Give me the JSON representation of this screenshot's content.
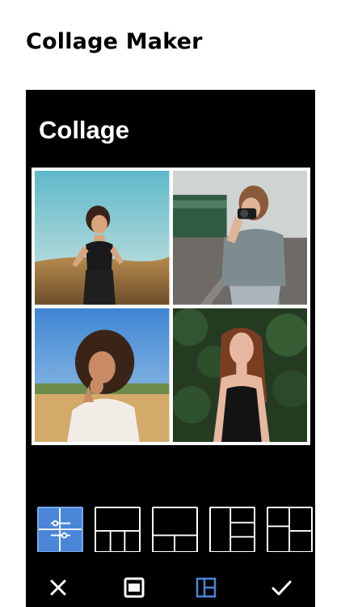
{
  "header": {
    "title": "Collage Maker"
  },
  "app": {
    "title": "Collage"
  },
  "collage": {
    "photos": [
      {
        "name": "woman-in-wheat-field-photo"
      },
      {
        "name": "woman-with-camera-on-tracks-photo"
      },
      {
        "name": "woman-curly-hair-field-photo"
      },
      {
        "name": "woman-long-hair-greenery-photo"
      }
    ]
  },
  "layouts": [
    {
      "name": "adjust-sliders",
      "icon": "sliders-icon",
      "selected": true
    },
    {
      "name": "layout-top-one-bottom-three",
      "icon": "grid-layout-icon",
      "selected": false
    },
    {
      "name": "layout-top-one-bottom-two",
      "icon": "grid-layout-icon",
      "selected": false
    },
    {
      "name": "layout-left-one-right-three",
      "icon": "grid-layout-icon",
      "selected": false
    },
    {
      "name": "layout-left-one-right-two",
      "icon": "grid-layout-icon",
      "selected": false
    }
  ],
  "toolbar": {
    "items": [
      {
        "name": "close",
        "icon": "close-icon"
      },
      {
        "name": "border",
        "icon": "border-icon"
      },
      {
        "name": "layout",
        "icon": "layout-icon",
        "accent": "#4a86d8"
      },
      {
        "name": "done",
        "icon": "check-icon"
      }
    ]
  },
  "colors": {
    "accent": "#4a86d8",
    "background": "#000000"
  }
}
